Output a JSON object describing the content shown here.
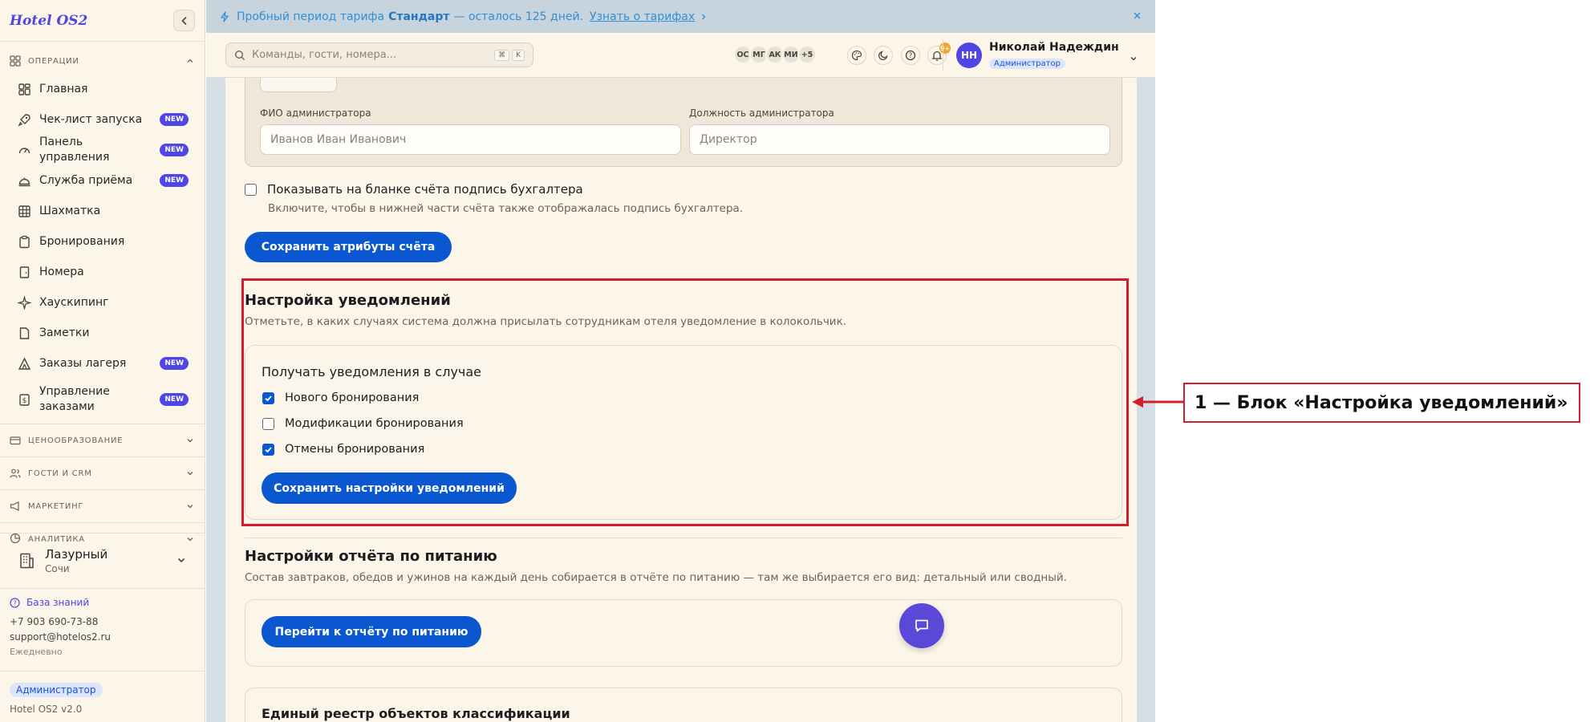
{
  "app": {
    "logo": "Hotel OS2"
  },
  "sidebar": {
    "groups": {
      "operations": "ОПЕРАЦИИ",
      "pricing": "ЦЕНООБРАЗОВАНИЕ",
      "guests": "ГОСТИ И CRM",
      "marketing": "МАРКЕТИНГ",
      "analytics": "АНАЛИТИКА"
    },
    "items": [
      {
        "label": "Главная",
        "icon": "home-grid-icon",
        "new": ""
      },
      {
        "label": "Чек-лист запуска",
        "icon": "rocket-icon",
        "new": "NEW"
      },
      {
        "label": "Панель управления",
        "icon": "gauge-icon",
        "new": "NEW"
      },
      {
        "label": "Служба приёма",
        "icon": "bell-desk-icon",
        "new": "NEW"
      },
      {
        "label": "Шахматка",
        "icon": "grid-icon",
        "new": ""
      },
      {
        "label": "Бронирования",
        "icon": "clipboard-icon",
        "new": ""
      },
      {
        "label": "Номера",
        "icon": "door-icon",
        "new": ""
      },
      {
        "label": "Хаускипинг",
        "icon": "sparkle-icon",
        "new": ""
      },
      {
        "label": "Заметки",
        "icon": "note-icon",
        "new": ""
      },
      {
        "label": "Заказы лагеря",
        "icon": "tent-icon",
        "new": "NEW"
      },
      {
        "label": "Управление заказами",
        "icon": "receipt-icon",
        "new": "NEW"
      }
    ],
    "hotel": {
      "name": "Лазурный",
      "city": "Сочи"
    },
    "support": {
      "kb": "База знаний",
      "phone": "+7 903 690-73-88",
      "email": "support@hotelos2.ru",
      "hours": "Ежедневно"
    },
    "role": "Администратор",
    "version": "Hotel OS2 v2.0"
  },
  "banner": {
    "prefix": "Пробный период тарифа",
    "plan": "Стандарт",
    "suffix": "— осталось 125 дней.",
    "link": "Узнать о тарифах"
  },
  "topbar": {
    "search_placeholder": "Команды, гости, номера...",
    "kbd1": "⌘",
    "kbd2": "K",
    "avatars": [
      "ОС",
      "МГ",
      "АК",
      "МИ",
      "+5"
    ],
    "notif_count": "9+",
    "user": {
      "initials": "НН",
      "name": "Николай Надеждин",
      "role": "Администратор"
    }
  },
  "main": {
    "admin_name_label": "ФИО администратора",
    "admin_name_placeholder": "Иванов Иван Иванович",
    "admin_pos_label": "Должность администратора",
    "admin_pos_placeholder": "Директор",
    "accountant_checkbox": {
      "label": "Показывать на бланке счёта подпись бухгалтера",
      "hint": "Включите, чтобы в нижней части счёта также отображалась подпись бухгалтера.",
      "checked": false
    },
    "save_invoice_btn": "Сохранить атрибуты счёта",
    "notifications": {
      "title": "Настройка уведомлений",
      "desc": "Отметьте, в каких случаях система должна присылать сотрудникам отеля уведомление в колокольчик.",
      "card_title": "Получать уведомления в случае",
      "options": [
        {
          "label": "Нового бронирования",
          "checked": true
        },
        {
          "label": "Модификации бронирования",
          "checked": false
        },
        {
          "label": "Отмены бронирования",
          "checked": true
        }
      ],
      "save_btn": "Сохранить настройки уведомлений"
    },
    "food": {
      "title": "Настройки отчёта по питанию",
      "desc": "Состав завтраков, обедов и ужинов на каждый день собирается в отчёте по питанию — там же выбирается его вид: детальный или сводный.",
      "btn": "Перейти к отчёту по питанию"
    },
    "registry": {
      "title": "Единый реестр объектов классификации"
    }
  },
  "annotation": {
    "label": "1 — Блок «Настройка уведомлений»",
    "color": "#d21f2d"
  },
  "colors": {
    "accent": "#4f46e5",
    "primary_button": "#0b57d0",
    "sidebar_bg": "#fbf5ea",
    "banner_bg": "#c7d4dd"
  }
}
